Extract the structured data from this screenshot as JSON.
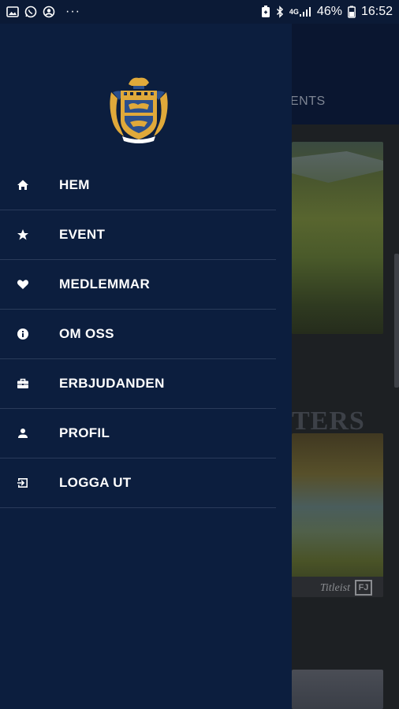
{
  "status_bar": {
    "battery_percent": "46%",
    "time": "16:52",
    "network": "4G"
  },
  "background": {
    "tab_label": "ENTS",
    "overlay_title": "TERS",
    "brand_text": "Titleist",
    "brand_badge": "FJ"
  },
  "drawer": {
    "logo": "club-crest-logo",
    "menu": [
      {
        "label": "HEM",
        "icon": "home-icon"
      },
      {
        "label": "EVENT",
        "icon": "star-icon"
      },
      {
        "label": "MEDLEMMAR",
        "icon": "heart-icon"
      },
      {
        "label": "OM OSS",
        "icon": "info-icon"
      },
      {
        "label": "ERBJUDANDEN",
        "icon": "briefcase-icon"
      },
      {
        "label": "PROFIL",
        "icon": "person-icon"
      },
      {
        "label": "LOGGA UT",
        "icon": "logout-icon"
      }
    ]
  },
  "colors": {
    "drawer_bg": "#0c1e3e",
    "divider": "#2a3b5a",
    "text": "#ffffff",
    "crest_gold": "#e0a93a",
    "crest_blue": "#2b4f8c"
  }
}
